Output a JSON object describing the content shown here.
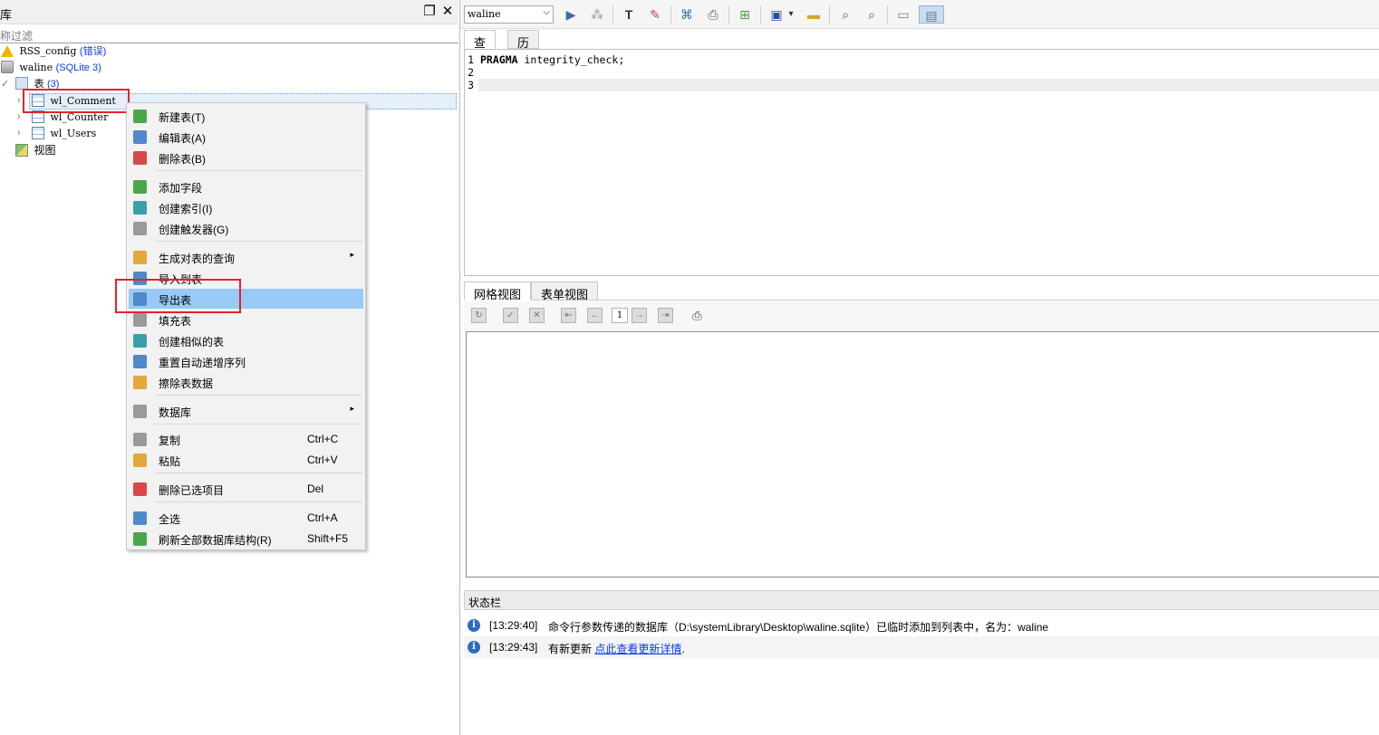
{
  "left_panel": {
    "title": "库",
    "filter_placeholder": "称过滤",
    "tree": {
      "rss": {
        "name": "RSS_config",
        "badge": "(错误)"
      },
      "waline": {
        "name": "waline",
        "badge": "(SQLite 3)"
      },
      "tables": {
        "name": "表",
        "count": "(3)"
      },
      "table_items": [
        "wl_Comment",
        "wl_Counter",
        "wl_Users"
      ],
      "views": {
        "name": "视图"
      }
    }
  },
  "context_menu": {
    "items": [
      {
        "label": "新建表(T)"
      },
      {
        "label": "编辑表(A)"
      },
      {
        "label": "删除表(B)"
      },
      {
        "label": "添加字段"
      },
      {
        "label": "创建索引(I)"
      },
      {
        "label": "创建触发器(G)"
      },
      {
        "label": "生成对表的查询",
        "submenu": "▸"
      },
      {
        "label": "导入到表"
      },
      {
        "label": "导出表"
      },
      {
        "label": "填充表"
      },
      {
        "label": "创建相似的表"
      },
      {
        "label": "重置自动递增序列"
      },
      {
        "label": "擦除表数据"
      },
      {
        "label": "数据库",
        "submenu": "▸"
      },
      {
        "label": "复制",
        "shortcut": "Ctrl+C"
      },
      {
        "label": "粘贴",
        "shortcut": "Ctrl+V"
      },
      {
        "label": "删除已选项目",
        "shortcut": "Del"
      },
      {
        "label": "全选",
        "shortcut": "Ctrl+A"
      },
      {
        "label": "刷新全部数据库结构(R)",
        "shortcut": "Shift+F5"
      }
    ]
  },
  "toolbar": {
    "db_select": "waline",
    "dropdown_glyph": "⌵",
    "buttons": {
      "run": "▶",
      "explain": "⁂",
      "format": "T",
      "clear": "✎",
      "export": "⌘",
      "print": "⎙",
      "import": "⊞",
      "save": "▣",
      "save_dd": "▾",
      "open": "▬",
      "find": "⌕",
      "replace": "⌕",
      "layout1": "▭",
      "layout2": "▤"
    }
  },
  "query_tabs": [
    "查询",
    "历史"
  ],
  "editor": {
    "line_numbers": [
      "1",
      "2",
      "3"
    ],
    "keyword": "PRAGMA",
    "rest": " integrity_check;"
  },
  "result_tabs": [
    "网格视图",
    "表单视图"
  ],
  "result_toolbar": {
    "page": "1",
    "buttons": {
      "refresh": "↻",
      "commit": "✓",
      "rollback": "✕",
      "first": "⇤",
      "prev": "←",
      "next": "→",
      "last": "⇥",
      "print": "⎙"
    }
  },
  "statusbar": {
    "title": "状态栏",
    "info_glyph": "i",
    "log": [
      {
        "time": "[13:29:40]",
        "message": "命令行参数传递的数据库（D:\\systemLibrary\\Desktop\\waline.sqlite）已临时添加到列表中，名为：waline"
      },
      {
        "time": "[13:29:43]",
        "message": "有新更新",
        "link": "点此查看更新详情",
        "tail": "."
      }
    ]
  },
  "header_buttons": {
    "restore": "❐",
    "close": "✕"
  },
  "tree_arrows": {
    "expanded": "✓",
    "collapsed": "›"
  }
}
